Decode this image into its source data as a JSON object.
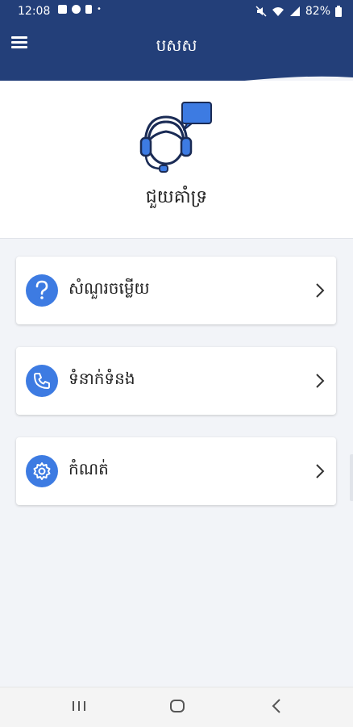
{
  "status_bar": {
    "time": "12:08",
    "battery": "82%"
  },
  "header": {
    "title": "បសស"
  },
  "hero": {
    "label": "ជួយគាំទ្រ"
  },
  "menu_items": [
    {
      "label": "សំណួរចម្លើយ",
      "icon": "question-icon"
    },
    {
      "label": "ទំនាក់ទំនង",
      "icon": "phone-icon"
    },
    {
      "label": "កំណត់",
      "icon": "gear-icon"
    }
  ],
  "colors": {
    "primary": "#233f79",
    "accent": "#3d7be2",
    "background": "#f2f4f8"
  }
}
